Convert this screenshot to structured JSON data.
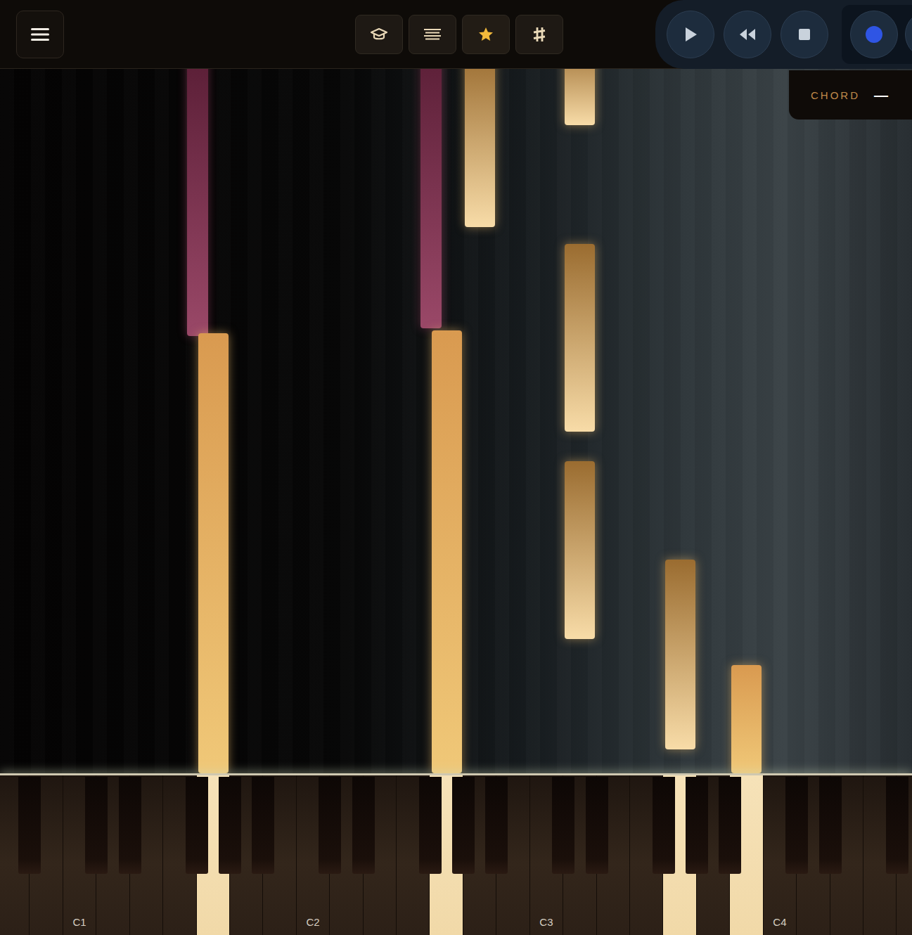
{
  "toolbar": [
    {
      "highlighted": false
    },
    {
      "highlighted": false
    },
    {
      "highlighted": true
    },
    {
      "highlighted": false
    }
  ],
  "chord": {
    "label": "CHORD",
    "value": "—"
  },
  "keyboard": {
    "labels": [
      "C1",
      "C2",
      "C3",
      "C4"
    ],
    "pressed": [
      "G1",
      "G2",
      "G3",
      "B3"
    ]
  },
  "notes": [
    {
      "key": "F#1",
      "start": 6.22,
      "length": 4.0,
      "playing": false,
      "color": "#9a4868"
    },
    {
      "key": "G1",
      "start": 0,
      "length": 6.26,
      "playing": true,
      "color": "#f0c878"
    },
    {
      "key": "F#2",
      "start": 6.33,
      "length": 4.0,
      "playing": false,
      "color": "#9a4868"
    },
    {
      "key": "G2",
      "start": 0,
      "length": 6.3,
      "playing": true,
      "color": "#f0c878"
    },
    {
      "key": "A2",
      "start": 7.77,
      "length": 2.5,
      "playing": false,
      "color": "#f8dca8"
    },
    {
      "key": "D3",
      "start": 9.22,
      "length": 1.2,
      "playing": false,
      "color": "#f8dca8"
    },
    {
      "key": "D3",
      "start": 4.86,
      "length": 2.67,
      "playing": false,
      "color": "#f8dca8"
    },
    {
      "key": "D3",
      "start": 1.91,
      "length": 2.53,
      "playing": false,
      "color": "#f8dca8"
    },
    {
      "key": "G3",
      "start": 0.34,
      "length": 2.7,
      "playing": false,
      "color": "#f8dca8"
    },
    {
      "key": "B3",
      "start": 0,
      "length": 1.54,
      "playing": true,
      "color": "#f0c878"
    }
  ]
}
